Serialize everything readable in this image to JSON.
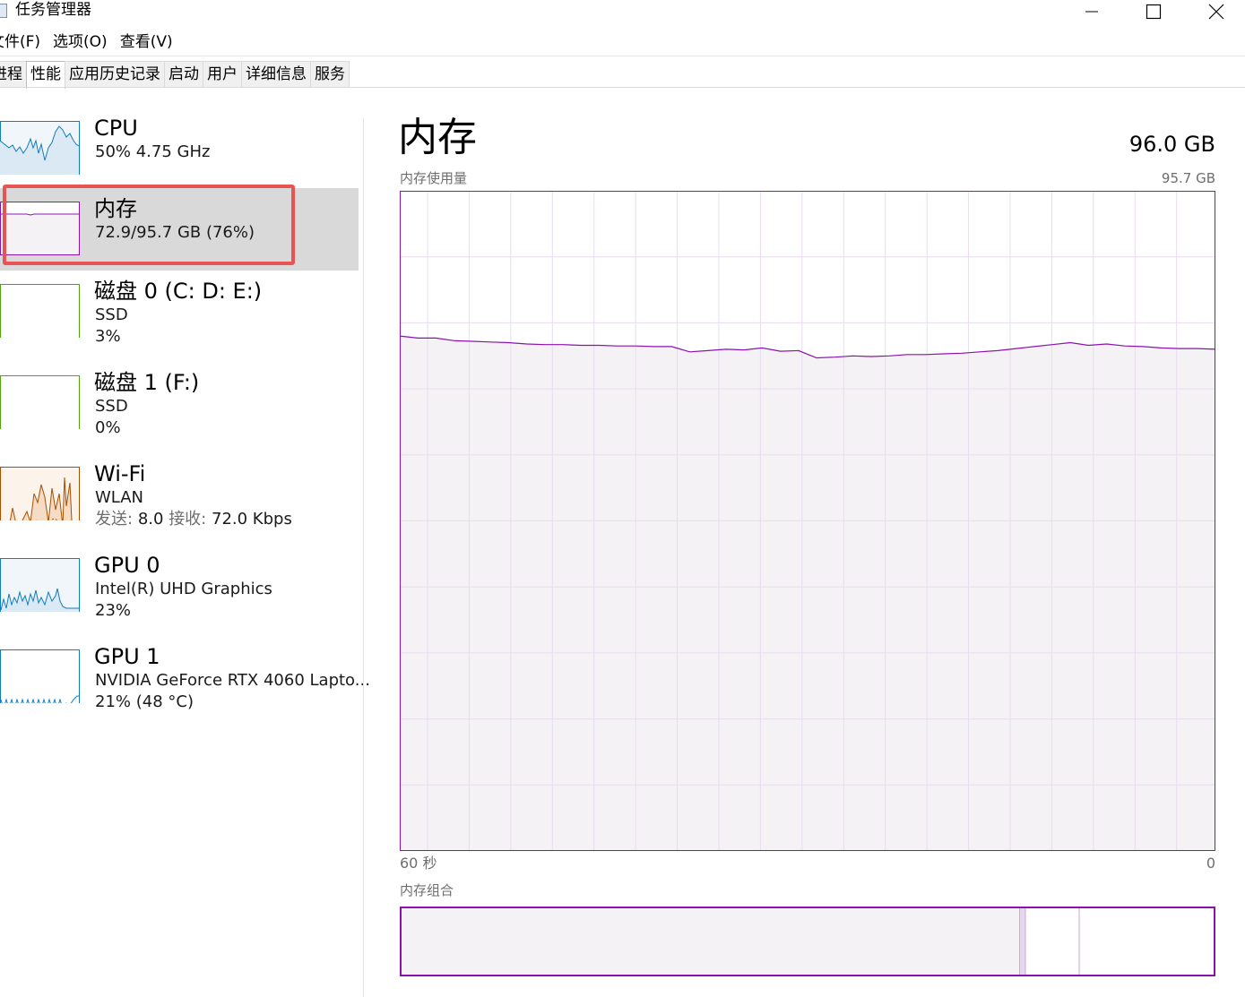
{
  "window": {
    "title": "任务管理器",
    "icon": "task-manager-icon"
  },
  "menu": [
    "文件(F)",
    "选项(O)",
    "查看(V)"
  ],
  "tabs": [
    {
      "label": "进程",
      "active": false
    },
    {
      "label": "性能",
      "active": true
    },
    {
      "label": "应用历史记录",
      "active": false
    },
    {
      "label": "启动",
      "active": false
    },
    {
      "label": "用户",
      "active": false
    },
    {
      "label": "详细信息",
      "active": false
    },
    {
      "label": "服务",
      "active": false
    }
  ],
  "sidebar": {
    "items": [
      {
        "title": "CPU",
        "sub1": "50%  4.75 GHz",
        "color": "#117dbb"
      },
      {
        "title": "内存",
        "sub1": "72.9/95.7 GB (76%)",
        "color": "#8b12ae",
        "selected": true
      },
      {
        "title": "磁盘 0 (C: D: E:)",
        "sub1": "SSD",
        "sub2": "3%",
        "color": "#4da60c"
      },
      {
        "title": "磁盘 1 (F:)",
        "sub1": "SSD",
        "sub2": "0%",
        "color": "#4da60c"
      },
      {
        "title": "Wi-Fi",
        "sub1": "WLAN",
        "sub2_send_label": "发送:",
        "sub2_send": "8.0",
        "sub2_recv_label": "接收:",
        "sub2_recv": "72.0 Kbps",
        "color": "#a74f01"
      },
      {
        "title": "GPU 0",
        "sub1": "Intel(R) UHD Graphics",
        "sub2": "23%",
        "color": "#117dbb"
      },
      {
        "title": "GPU 1",
        "sub1": "NVIDIA GeForce RTX 4060 Lapto...",
        "sub2": "21%  (48 °C)",
        "color": "#117dbb"
      }
    ]
  },
  "main": {
    "title": "内存",
    "total": "96.0 GB",
    "usage_label": "内存使用量",
    "usage_max": "95.7 GB",
    "time_left": "60 秒",
    "time_right": "0",
    "composition_label": "内存组合"
  },
  "colors": {
    "memory": "#8b12ae",
    "memory_fill": "#f4f2f4",
    "grid": "#e8dcef",
    "selection": "#d9d9d9",
    "highlight": "#e85454"
  },
  "chart_data": {
    "type": "area",
    "y_unit": "%",
    "ylim": [
      0,
      100
    ],
    "xlim": [
      60,
      0
    ],
    "values": [
      78.0,
      77.7,
      77.7,
      77.3,
      77.2,
      77.1,
      77.0,
      76.8,
      76.7,
      76.7,
      76.6,
      76.6,
      76.5,
      76.5,
      76.4,
      76.4,
      75.6,
      75.8,
      76.0,
      75.9,
      76.2,
      75.7,
      75.8,
      74.7,
      74.8,
      75.0,
      74.9,
      75.0,
      75.2,
      75.2,
      75.3,
      75.4,
      75.6,
      75.8,
      76.1,
      76.4,
      76.7,
      77.0,
      76.6,
      76.8,
      76.5,
      76.4,
      76.2,
      76.1,
      76.1,
      76.0
    ]
  },
  "composition": {
    "in_use_fraction": 0.76,
    "modified_fraction": 0.007,
    "standby_fraction": 0.066
  }
}
